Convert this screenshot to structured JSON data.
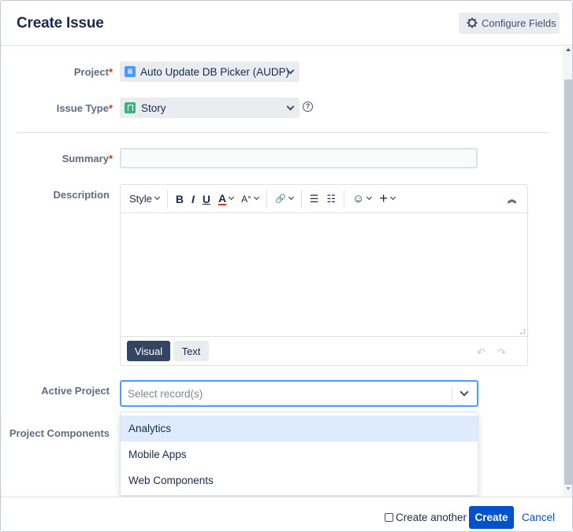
{
  "dialog": {
    "title": "Create Issue",
    "configure_fields_label": "Configure Fields"
  },
  "form": {
    "project": {
      "label": "Project",
      "required_mark": "*",
      "value": "Auto Update DB Picker (AUDP)"
    },
    "issue_type": {
      "label": "Issue Type",
      "required_mark": "*",
      "value": "Story",
      "help_symbol": "?"
    },
    "summary": {
      "label": "Summary",
      "required_mark": "*",
      "value": ""
    },
    "description": {
      "label": "Description",
      "toolbar": {
        "style_label": "Style",
        "bold": "B",
        "italic": "I",
        "underline": "U",
        "text_color": "A",
        "more_format": "A°",
        "link": "🔗",
        "bullet_list": "☰",
        "number_list": "☷",
        "emoji": "☺",
        "insert": "+",
        "collapse": "︽"
      },
      "modes": {
        "visual": "Visual",
        "text": "Text"
      },
      "undo": "↶",
      "redo": "↷"
    },
    "active_project": {
      "label": "Active Project",
      "placeholder": "Select record(s)",
      "options": [
        "Analytics",
        "Mobile Apps",
        "Web Components"
      ],
      "highlighted_index": 0
    },
    "project_components": {
      "label": "Project Components"
    }
  },
  "footer": {
    "create_another_label": "Create another",
    "create_another_checked": false,
    "create_label": "Create",
    "cancel_label": "Cancel"
  },
  "colors": {
    "primary": "#0052cc",
    "required": "#de350b",
    "highlight": "#deebff",
    "focus_border": "#4c9aff"
  },
  "icons": {
    "configure": "gear-icon",
    "project": "project-avatar-icon",
    "issue_type": "story-icon",
    "help": "help-icon",
    "dropdown": "chevron-down-icon"
  }
}
